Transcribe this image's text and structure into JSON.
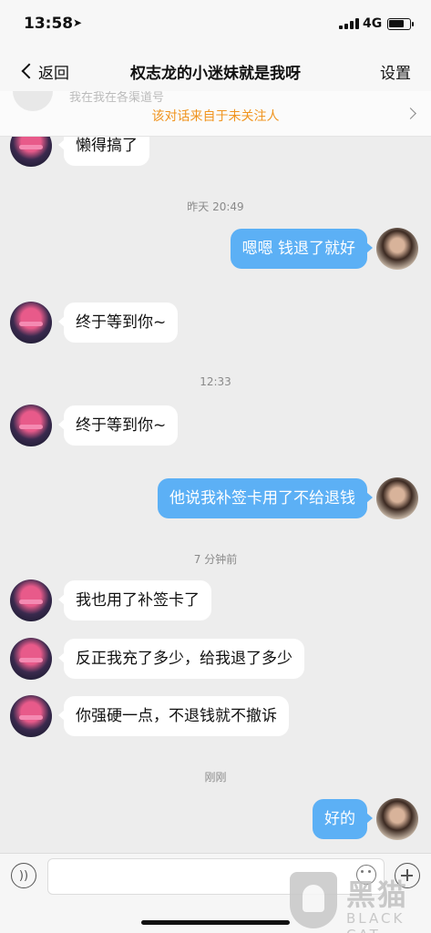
{
  "status_bar": {
    "time": "13:58",
    "network": "4G"
  },
  "nav": {
    "back_label": "返回",
    "title": "权志龙的小迷妹就是我呀",
    "settings_label": "设置"
  },
  "banner": {
    "text": "该对话来自于未关注人",
    "ghost_text": "我在我在各渠道号"
  },
  "messages": [
    {
      "type": "text",
      "side": "left",
      "text": "懒得搞了"
    },
    {
      "type": "time",
      "text": "昨天 20:49"
    },
    {
      "type": "text",
      "side": "right",
      "text": "嗯嗯 钱退了就好"
    },
    {
      "type": "text",
      "side": "left",
      "text": "终于等到你~"
    },
    {
      "type": "time",
      "text": "12:33"
    },
    {
      "type": "text",
      "side": "left",
      "text": "终于等到你~"
    },
    {
      "type": "text",
      "side": "right",
      "text": "他说我补签卡用了不给退钱"
    },
    {
      "type": "time",
      "text": "7 分钟前"
    },
    {
      "type": "text",
      "side": "left",
      "text": "我也用了补签卡了"
    },
    {
      "type": "text",
      "side": "left",
      "text": "反正我充了多少，给我退了多少"
    },
    {
      "type": "text",
      "side": "left",
      "text": "你强硬一点，不退钱就不撤诉"
    },
    {
      "type": "time",
      "text": "刚刚"
    },
    {
      "type": "text",
      "side": "right",
      "text": "好的"
    }
  ],
  "input": {
    "placeholder": ""
  },
  "watermark": {
    "cn": "黑猫",
    "en": "BLACK CAT"
  },
  "colors": {
    "accent_bubble": "#5cb0f5",
    "banner_text": "#f0941f",
    "background": "#ededed"
  }
}
